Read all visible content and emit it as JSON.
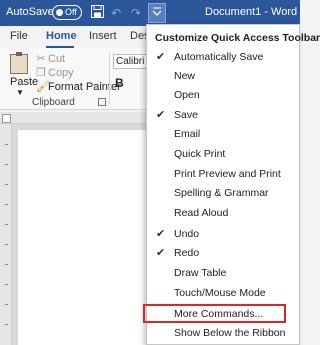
{
  "titlebar": {
    "autosave_label": "AutoSave",
    "autosave_state": "Off",
    "doc_title": "Document1 - Word"
  },
  "tabs": [
    "File",
    "Home",
    "Insert",
    "Desi"
  ],
  "ribbon": {
    "paste_label": "Paste",
    "cut_label": "Cut",
    "copy_label": "Copy",
    "format_painter_label": "Format Painter",
    "clipboard_group_label": "Clipboard",
    "font_name": "Calibri (B",
    "bold_label": "B"
  },
  "menu": {
    "title": "Customize Quick Access Toolbar",
    "items": [
      {
        "label": "Automatically Save",
        "checked": true
      },
      {
        "label": "New",
        "checked": false
      },
      {
        "label": "Open",
        "checked": false
      },
      {
        "label": "Save",
        "checked": true
      },
      {
        "label": "Email",
        "checked": false
      },
      {
        "label": "Quick Print",
        "checked": false
      },
      {
        "label": "Print Preview and Print",
        "checked": false
      },
      {
        "label": "Spelling & Grammar",
        "checked": false
      },
      {
        "label": "Read Aloud",
        "checked": false
      },
      {
        "label": "Undo",
        "checked": true
      },
      {
        "label": "Redo",
        "checked": true
      },
      {
        "label": "Draw Table",
        "checked": false
      },
      {
        "label": "Touch/Mouse Mode",
        "checked": false
      },
      {
        "label": "More Commands...",
        "checked": false
      },
      {
        "label": "Show Below the Ribbon",
        "checked": false
      }
    ],
    "check_glyph": "✔"
  },
  "colors": {
    "titlebar_bg": "#2b579a",
    "highlight_border": "#d9272e"
  }
}
